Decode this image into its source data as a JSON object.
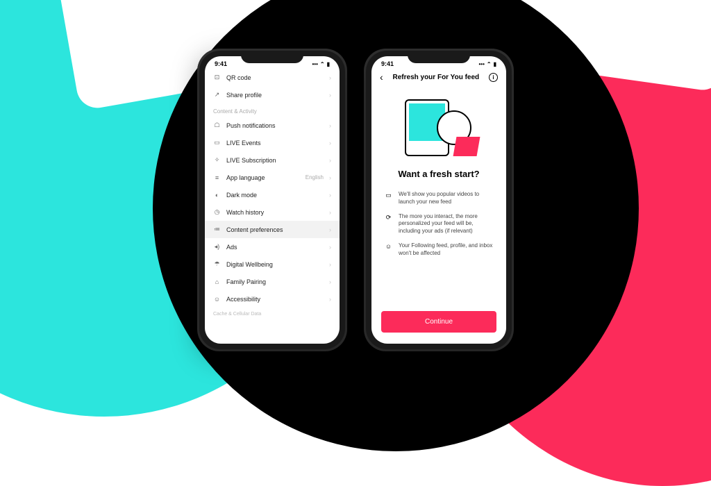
{
  "status": {
    "time": "9:41",
    "signal": "•••",
    "wifi": "⌃",
    "battery": "▮"
  },
  "left": {
    "rows": [
      {
        "icon": "⊡",
        "name": "qr-code",
        "label": "QR code"
      },
      {
        "icon": "↗",
        "name": "share-profile",
        "label": "Share profile"
      }
    ],
    "section_header": "Content & Activity",
    "items": [
      {
        "icon": "☖",
        "name": "push-notifications",
        "label": "Push notifications"
      },
      {
        "icon": "▭",
        "name": "live-events",
        "label": "LIVE Events"
      },
      {
        "icon": "✧",
        "name": "live-subscription",
        "label": "LIVE Subscription"
      },
      {
        "icon": "≡",
        "name": "app-language",
        "label": "App language",
        "value": "English"
      },
      {
        "icon": "◐",
        "name": "dark-mode",
        "label": "Dark mode"
      },
      {
        "icon": "◷",
        "name": "watch-history",
        "label": "Watch history"
      },
      {
        "icon": "≔",
        "name": "content-preferences",
        "label": "Content preferences",
        "hl": true
      },
      {
        "icon": "◂)",
        "name": "ads",
        "label": "Ads"
      },
      {
        "icon": "☂",
        "name": "digital-wellbeing",
        "label": "Digital Wellbeing"
      },
      {
        "icon": "⌂",
        "name": "family-pairing",
        "label": "Family Pairing"
      },
      {
        "icon": "☺",
        "name": "accessibility",
        "label": "Accessibility"
      }
    ],
    "footer": "Cache & Cellular Data"
  },
  "right": {
    "nav_title": "Refresh your For You feed",
    "headline": "Want a fresh start?",
    "bullets": [
      {
        "icon": "▭",
        "name": "video-icon",
        "text": "We'll show you popular videos to launch your new feed"
      },
      {
        "icon": "⟳",
        "name": "refresh-icon",
        "text": "The more you interact, the more personalized your feed will be, including your ads (if relevant)"
      },
      {
        "icon": "☺",
        "name": "person-icon",
        "text": "Your Following feed, profile, and inbox won't be affected"
      }
    ],
    "cta": "Continue"
  }
}
